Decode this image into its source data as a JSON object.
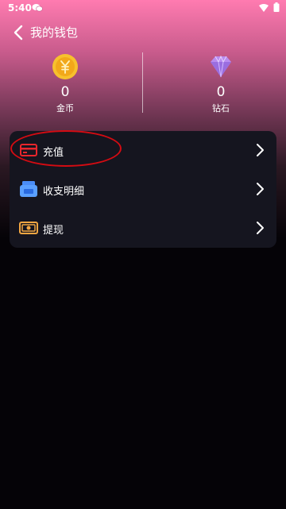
{
  "status_bar": {
    "time": "5:40"
  },
  "header": {
    "title": "我的钱包"
  },
  "balances": [
    {
      "value": "0",
      "label": "金币",
      "icon": "gold-coin-icon"
    },
    {
      "value": "0",
      "label": "钻石",
      "icon": "diamond-icon"
    }
  ],
  "menu": [
    {
      "label": "充值",
      "icon": "credit-card-icon"
    },
    {
      "label": "收支明细",
      "icon": "wallet-icon"
    },
    {
      "label": "提现",
      "icon": "cash-icon"
    }
  ],
  "colors": {
    "accent_pink": "#ff7bb0",
    "card_bg": "#15151f",
    "highlight_red": "#d40b12"
  }
}
